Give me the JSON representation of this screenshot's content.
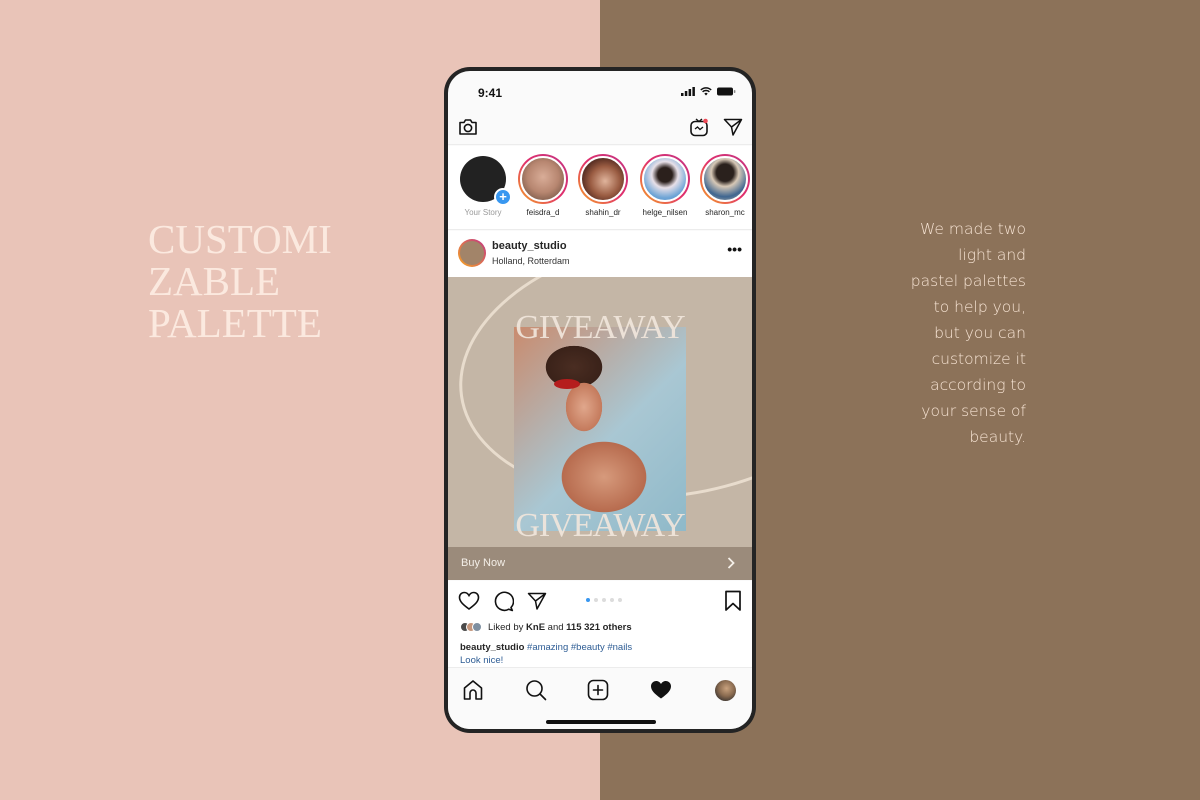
{
  "colors": {
    "left_bg": "#e9c4b8",
    "right_bg": "#8c7259",
    "headline": "#fbe9df",
    "blurb": "#f6e3d3",
    "post_bg": "#c4b6a6",
    "buy_bar": "#9b8b7b",
    "accent_blue": "#3897f0",
    "hashtag": "#2d5c94"
  },
  "headline": {
    "lines": [
      "CUSTOMI",
      "ZABLE",
      "PALETTE"
    ]
  },
  "blurb": {
    "lines": [
      "We made two",
      "light and",
      "pastel palettes",
      "to help you,",
      "but you can",
      "customize it",
      "according to",
      "your sense of",
      "beauty."
    ]
  },
  "phone": {
    "status_bar": {
      "time": "9:41",
      "icons": [
        "signal-icon",
        "wifi-icon",
        "battery-icon"
      ]
    },
    "topbar": {
      "left_icon": "camera-icon",
      "right_icons": [
        "igtv-icon",
        "direct-message-icon"
      ]
    },
    "stories": [
      {
        "label": "Your Story",
        "own": true
      },
      {
        "label": "feisdra_d",
        "color": "#c99a84"
      },
      {
        "label": "shahin_dr",
        "color": "#8a5a48"
      },
      {
        "label": "helge_nilsen",
        "color": "#6d9bc6"
      },
      {
        "label": "sharon_mc",
        "color": "#6a7f95"
      }
    ],
    "post": {
      "username": "beauty_studio",
      "location": "Holland, Rotterdam",
      "more_icon": "more-horizontal-icon",
      "image_title_top": "GIVEAWAY",
      "image_title_bottom": "GIVEAWAY",
      "cta_label": "Buy Now",
      "carousel": {
        "count": 5,
        "active": 0
      },
      "likes": {
        "prefix": "Liked by",
        "user": "KnE",
        "middle": "and",
        "others": "115 321 others"
      },
      "caption": {
        "username": "beauty_studio",
        "hashtags": [
          "#amazing",
          "#beauty",
          "#nails"
        ],
        "second_line": "Look nice!"
      }
    },
    "tabbar": [
      "home-icon",
      "search-icon",
      "new-post-icon",
      "activity-heart-icon",
      "profile-avatar"
    ]
  }
}
